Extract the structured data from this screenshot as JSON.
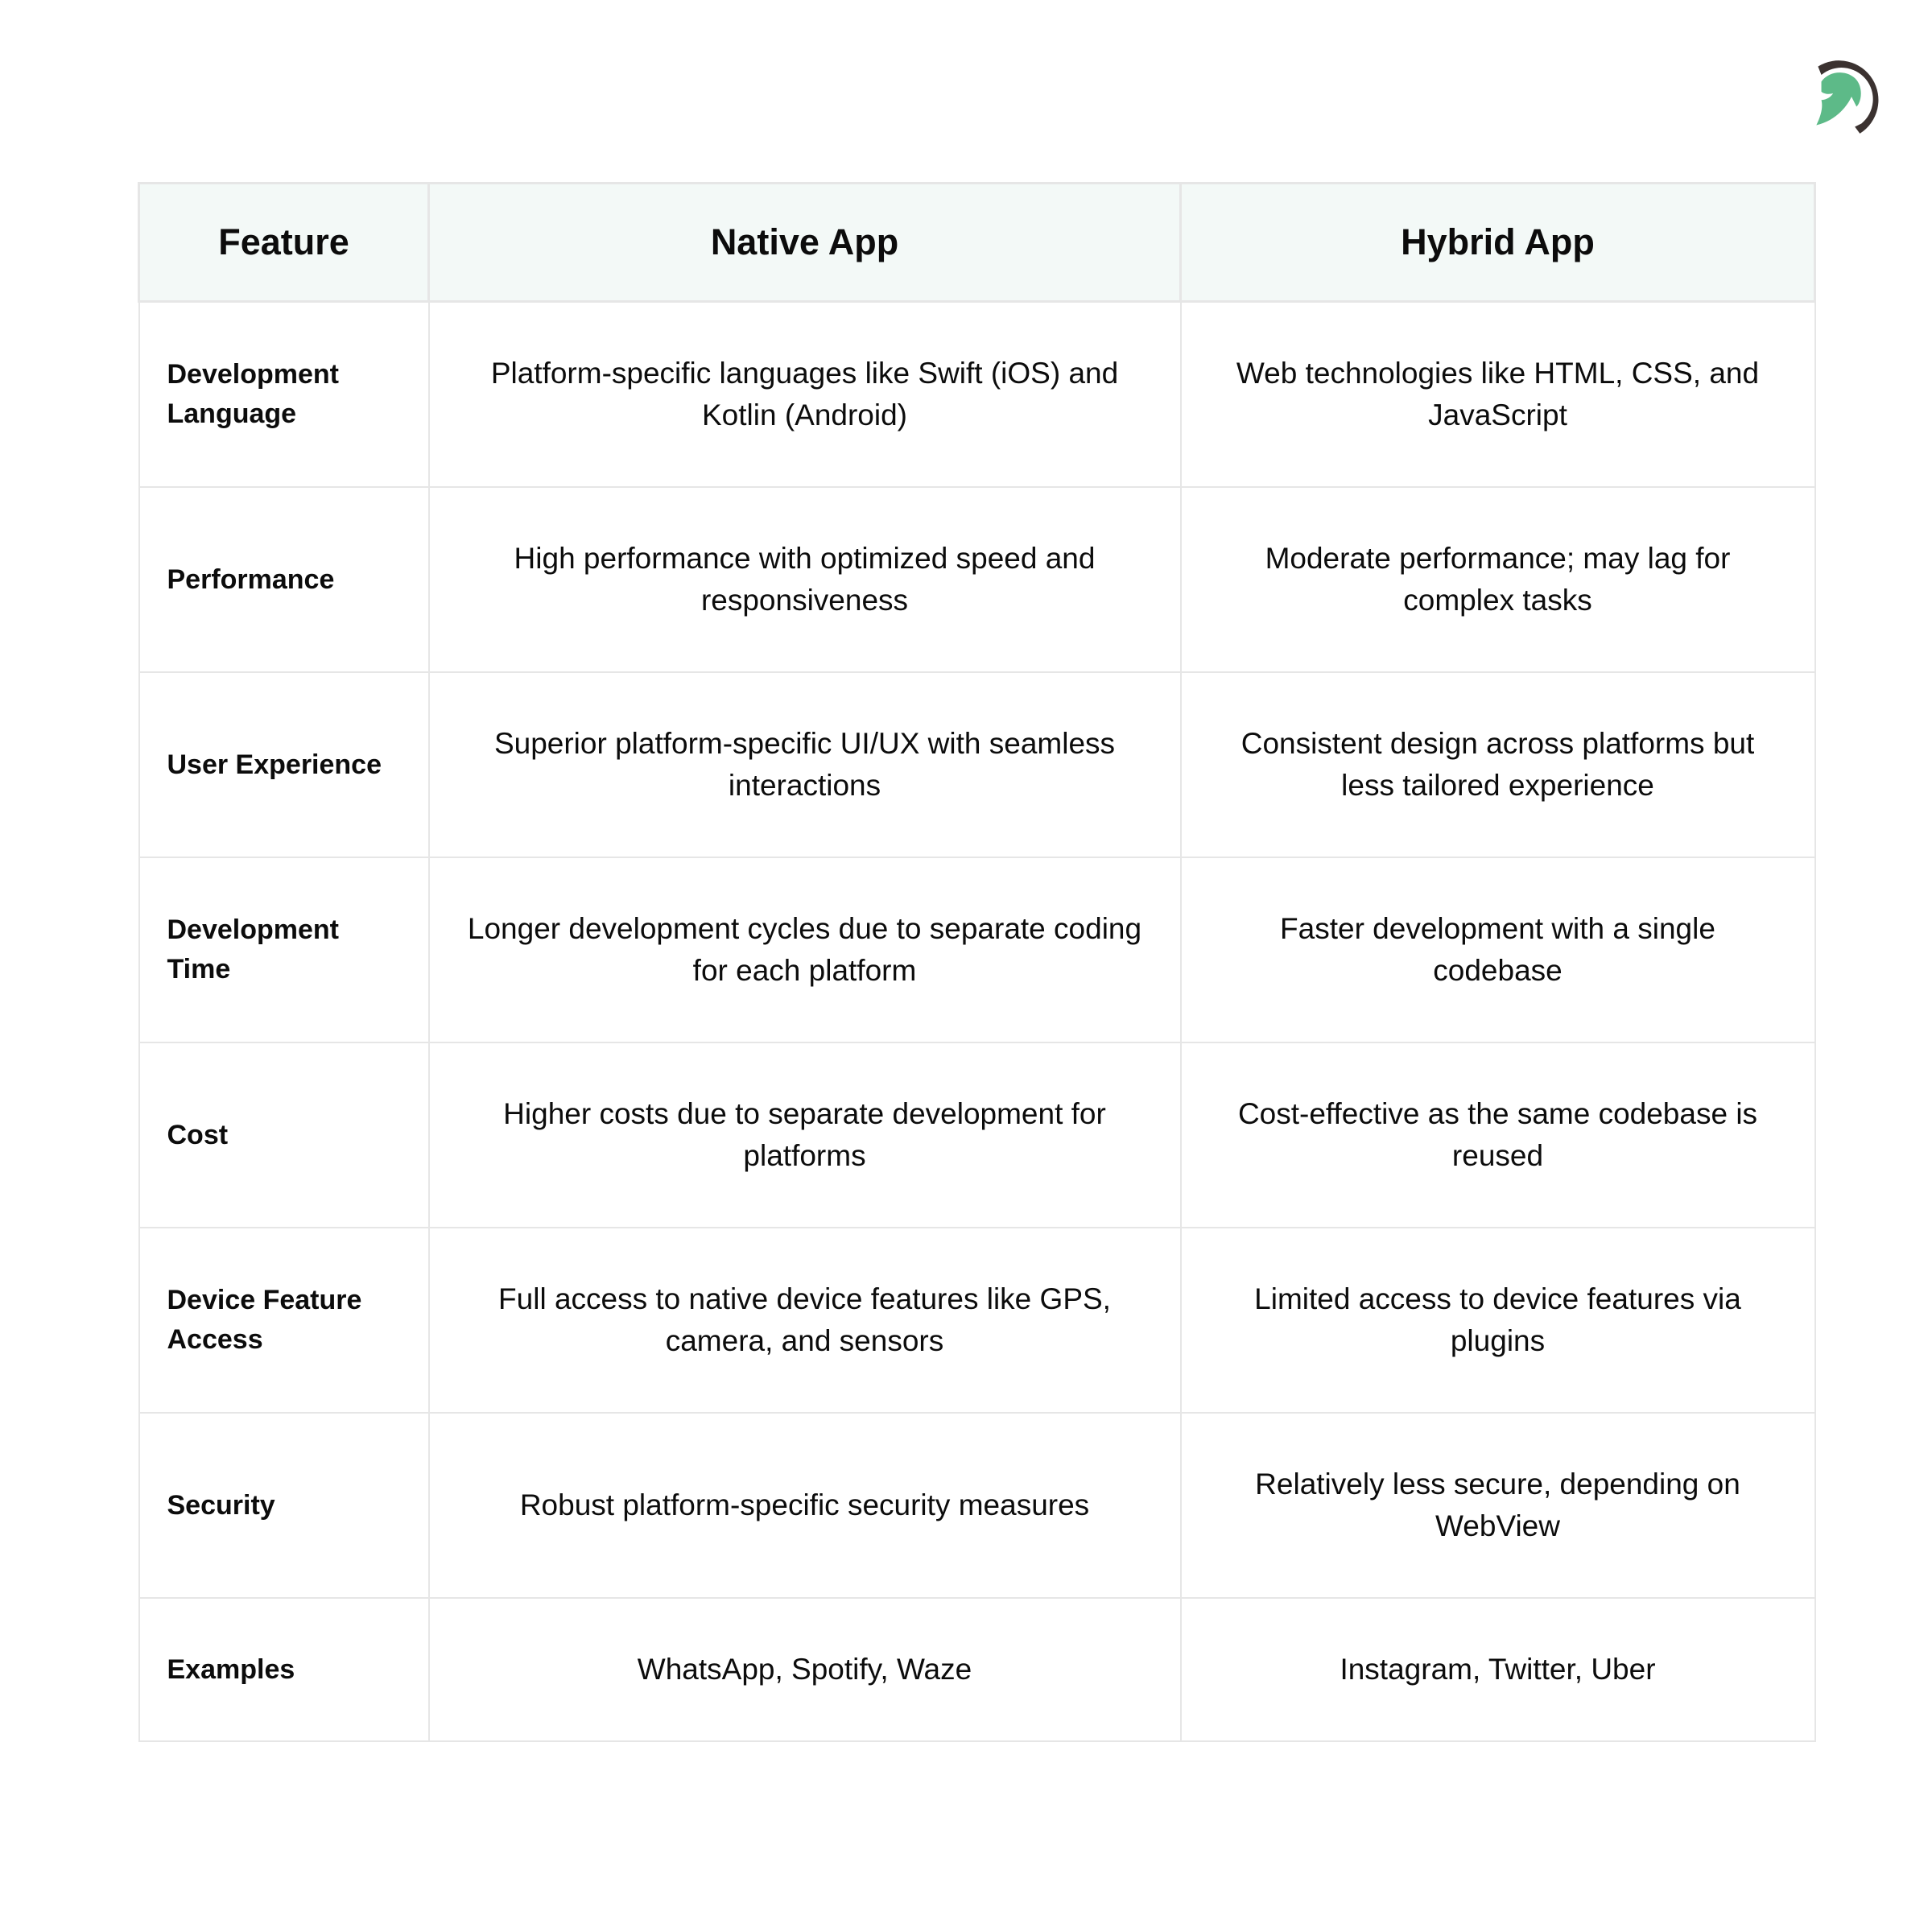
{
  "brand": {
    "logo_icon": "helmet-logo-icon",
    "colors": {
      "logo_green": "#5dba88",
      "logo_dark": "#3b3230",
      "header_bg": "#f3f9f7",
      "border": "#e6e6e6"
    }
  },
  "table": {
    "headers": [
      "Feature",
      "Native App",
      "Hybrid App"
    ],
    "rows": [
      {
        "feature": "Development Language",
        "native": "Platform-specific languages like Swift (iOS) and Kotlin (Android)",
        "hybrid": "Web technologies like HTML, CSS, and JavaScript"
      },
      {
        "feature": "Performance",
        "native": "High performance with optimized speed and responsiveness",
        "hybrid": "Moderate performance; may lag for complex tasks"
      },
      {
        "feature": "User Experience",
        "native": "Superior platform-specific UI/UX with seamless interactions",
        "hybrid": "Consistent design across platforms but less tailored experience"
      },
      {
        "feature": "Development Time",
        "native": "Longer development cycles due to separate coding for each platform",
        "hybrid": "Faster development with a single codebase"
      },
      {
        "feature": "Cost",
        "native": "Higher costs due to separate development for platforms",
        "hybrid": "Cost-effective as the same codebase is reused"
      },
      {
        "feature": "Device Feature Access",
        "native": "Full access to native device features like GPS, camera, and sensors",
        "hybrid": "Limited access to device features via plugins"
      },
      {
        "feature": "Security",
        "native": "Robust platform-specific security measures",
        "hybrid": "Relatively less secure, depending on WebView"
      },
      {
        "feature": "Examples",
        "native": "WhatsApp, Spotify, Waze",
        "hybrid": "Instagram, Twitter, Uber"
      }
    ]
  }
}
